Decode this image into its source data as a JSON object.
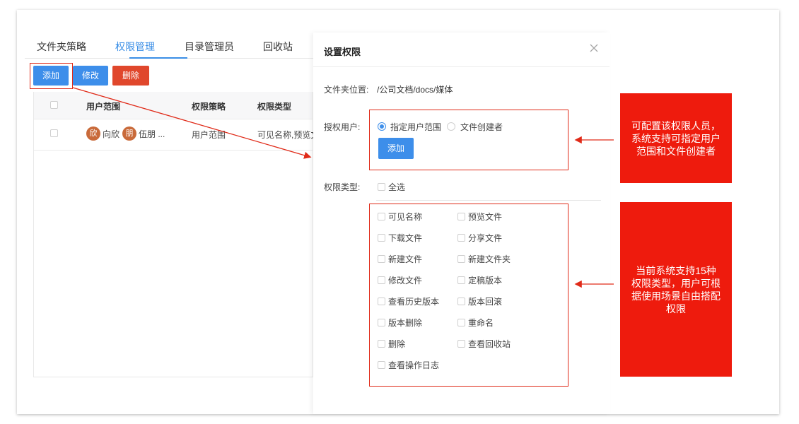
{
  "tabs": [
    {
      "label": "文件夹策略"
    },
    {
      "label": "权限管理",
      "active": true
    },
    {
      "label": "目录管理员"
    },
    {
      "label": "回收站"
    }
  ],
  "toolbar": {
    "add_label": "添加",
    "edit_label": "修改",
    "delete_label": "删除"
  },
  "table": {
    "headers": {
      "scope": "用户范围",
      "policy": "权限策略",
      "type": "权限类型"
    },
    "rows": [
      {
        "user1_avatar": "欣",
        "user1_name": "向欣",
        "user2_avatar": "朋",
        "user2_name": "伍朋 ...",
        "policy": "用户范围",
        "type": "可见名称,预览文"
      }
    ]
  },
  "panel": {
    "title": "设置权限",
    "location_label": "文件夹位置:",
    "location_value": "/公司文档/docs/媒体",
    "auth_label": "授权用户:",
    "radio_specified": "指定用户范围",
    "radio_creator": "文件创建者",
    "add_label": "添加",
    "type_label": "权限类型:",
    "select_all": "全选",
    "permissions": [
      "可见名称",
      "预览文件",
      "下载文件",
      "分享文件",
      "新建文件",
      "新建文件夹",
      "修改文件",
      "定稿版本",
      "查看历史版本",
      "版本回滚",
      "版本删除",
      "重命名",
      "删除",
      "查看回收站",
      "查看操作日志"
    ]
  },
  "notes": {
    "note1": "可配置该权限人员，系统支持可指定用户范围和文件创建者",
    "note2": "当前系统支持15种权限类型，用户可根据使用场景自由搭配权限"
  },
  "colors": {
    "accent": "#3d8eea",
    "danger": "#e0472c",
    "highlight": "#ee1b0d"
  }
}
